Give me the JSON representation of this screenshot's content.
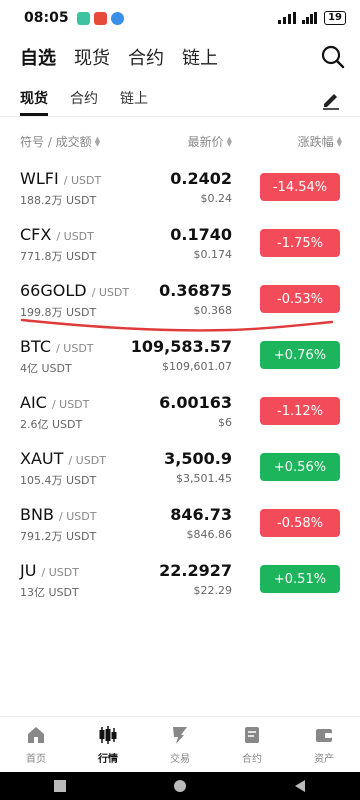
{
  "status": {
    "time": "08:05",
    "battery": "19",
    "app_colors": [
      "#3ec3a1",
      "#e64a3a",
      "#3a8fe6"
    ]
  },
  "top_tabs": [
    {
      "label": "自选",
      "active": true
    },
    {
      "label": "现货",
      "active": false
    },
    {
      "label": "合约",
      "active": false
    },
    {
      "label": "链上",
      "active": false
    }
  ],
  "sub_tabs": [
    {
      "label": "现货",
      "active": true
    },
    {
      "label": "合约",
      "active": false
    },
    {
      "label": "链上",
      "active": false
    }
  ],
  "columns": {
    "symbol": "符号 / 成交额",
    "price": "最新价",
    "change": "涨跌幅"
  },
  "rows": [
    {
      "base": "WLFI",
      "quote": "/ USDT",
      "volume": "188.2万 USDT",
      "price": "0.2402",
      "usd": "$0.24",
      "change": "-14.54%",
      "dir": "down"
    },
    {
      "base": "CFX",
      "quote": "/ USDT",
      "volume": "771.8万 USDT",
      "price": "0.1740",
      "usd": "$0.174",
      "change": "-1.75%",
      "dir": "down"
    },
    {
      "base": "66GOLD",
      "quote": "/ USDT",
      "volume": "199.8万 USDT",
      "price": "0.36875",
      "usd": "$0.368",
      "change": "-0.53%",
      "dir": "down"
    },
    {
      "base": "BTC",
      "quote": "/ USDT",
      "volume": "4亿 USDT",
      "price": "109,583.57",
      "usd": "$109,601.07",
      "change": "+0.76%",
      "dir": "up"
    },
    {
      "base": "AIC",
      "quote": "/ USDT",
      "volume": "2.6亿 USDT",
      "price": "6.00163",
      "usd": "$6",
      "change": "-1.12%",
      "dir": "down"
    },
    {
      "base": "XAUT",
      "quote": "/ USDT",
      "volume": "105.4万 USDT",
      "price": "3,500.9",
      "usd": "$3,501.45",
      "change": "+0.56%",
      "dir": "up"
    },
    {
      "base": "BNB",
      "quote": "/ USDT",
      "volume": "791.2万 USDT",
      "price": "846.73",
      "usd": "$846.86",
      "change": "-0.58%",
      "dir": "down"
    },
    {
      "base": "JU",
      "quote": "/ USDT",
      "volume": "13亿 USDT",
      "price": "22.2927",
      "usd": "$22.29",
      "change": "+0.51%",
      "dir": "up"
    }
  ],
  "bottom_nav": [
    {
      "label": "首页",
      "icon": "home-icon",
      "active": false
    },
    {
      "label": "行情",
      "icon": "candlestick-icon",
      "active": true
    },
    {
      "label": "交易",
      "icon": "trade-icon",
      "active": false
    },
    {
      "label": "合约",
      "icon": "contract-icon",
      "active": false
    },
    {
      "label": "资产",
      "icon": "wallet-icon",
      "active": false
    }
  ],
  "colors": {
    "down": "#f44b5b",
    "up": "#1cb55c",
    "annotation": "#e03a3a"
  }
}
